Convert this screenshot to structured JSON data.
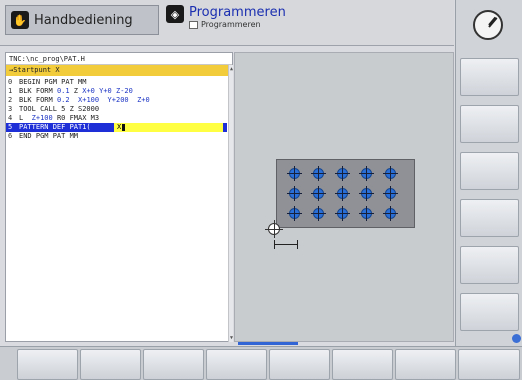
{
  "header": {
    "manual_mode_label": "Handbediening",
    "program_mode_label": "Programmeren",
    "program_mode_sub": "Programmeren"
  },
  "program": {
    "path": "TNC:\\nc_prog\\PAT.H",
    "start_point_prompt": "→Startpunt X",
    "lines": [
      {
        "num": "0",
        "parts": [
          {
            "t": "BEGIN PGM PAT MM",
            "c": "k"
          }
        ]
      },
      {
        "num": "1",
        "parts": [
          {
            "t": "BLK FORM ",
            "c": "k"
          },
          {
            "t": "0.1",
            "c": "b"
          },
          {
            "t": " Z ",
            "c": "k"
          },
          {
            "t": "X+0",
            "c": "b"
          },
          {
            "t": " ",
            "c": "k"
          },
          {
            "t": "Y+0",
            "c": "b"
          },
          {
            "t": " ",
            "c": "k"
          },
          {
            "t": "Z-20",
            "c": "b"
          }
        ]
      },
      {
        "num": "2",
        "parts": [
          {
            "t": "BLK FORM ",
            "c": "k"
          },
          {
            "t": "0.2",
            "c": "b"
          },
          {
            "t": "  ",
            "c": "k"
          },
          {
            "t": "X+100",
            "c": "b"
          },
          {
            "t": "  ",
            "c": "k"
          },
          {
            "t": "Y+200",
            "c": "b"
          },
          {
            "t": "  ",
            "c": "k"
          },
          {
            "t": "Z+0",
            "c": "b"
          }
        ]
      },
      {
        "num": "3",
        "parts": [
          {
            "t": "TOOL CALL 5 Z S2000",
            "c": "k"
          }
        ]
      },
      {
        "num": "4",
        "parts": [
          {
            "t": "L  ",
            "c": "k"
          },
          {
            "t": "Z+100",
            "c": "b"
          },
          {
            "t": " R0 FMAX M3",
            "c": "k"
          }
        ]
      },
      {
        "num": "5",
        "parts": [
          {
            "t": "PATTERN DEF PAT1(",
            "c": "k"
          }
        ]
      },
      {
        "num": "6",
        "parts": [
          {
            "t": "END PGM PAT MM",
            "c": "k"
          }
        ]
      }
    ],
    "active_line_index": 5,
    "edit_field_value": "X"
  },
  "graphics": {
    "hole_rows": 3,
    "hole_cols": 5
  },
  "softkeys": {
    "count": 8,
    "vertical_count": 6
  }
}
